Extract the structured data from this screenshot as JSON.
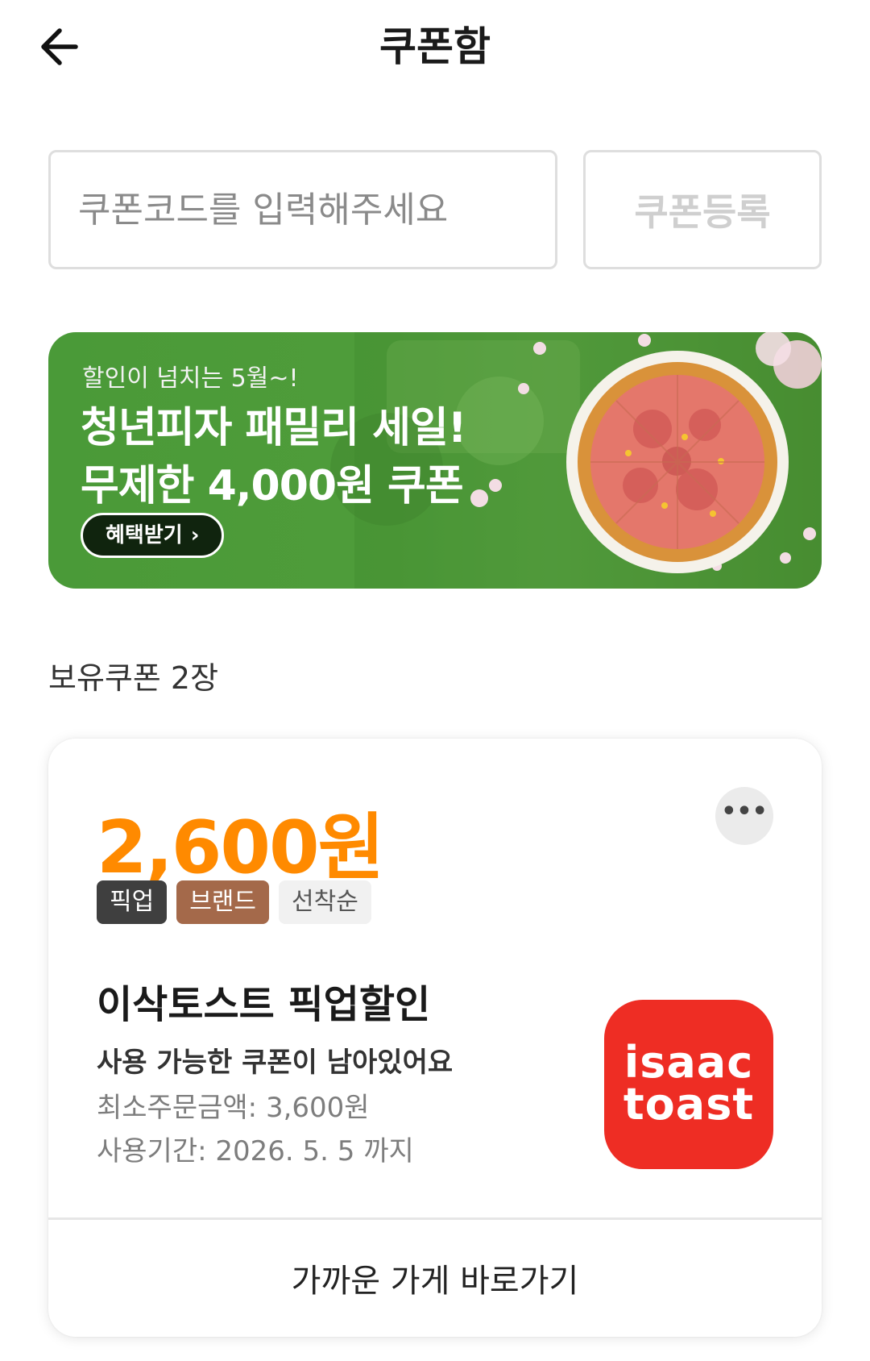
{
  "header": {
    "title": "쿠폰함",
    "back_icon": "arrow-left-icon"
  },
  "coupon_code": {
    "placeholder": "쿠폰코드를 입력해주세요",
    "value": "",
    "register_label": "쿠폰등록"
  },
  "banner": {
    "subtitle": "할인이 넘치는 5월~!",
    "line1": "청년피자 패밀리 세일!",
    "line2": "무제한 4,000원 쿠폰",
    "cta_label": "혜택받기",
    "cta_icon": "›"
  },
  "owned": {
    "label": "보유쿠폰 2장"
  },
  "coupon": {
    "amount": "2,600원",
    "more_icon": "•••",
    "tags": [
      "픽업",
      "브랜드",
      "선착순"
    ],
    "name": "이삭토스트 픽업할인",
    "status": "사용 가능한 쿠폰이 남아있어요",
    "min_order": "최소주문금액: 3,600원",
    "valid_until": "사용기간: 2026. 5. 5 까지",
    "brand_logo": {
      "line1": "isaac",
      "line2": "toast"
    },
    "store_link": "가까운 가게 바로가기"
  },
  "colors": {
    "accent": "#ff8a00",
    "banner_green": "#4f9c3a",
    "tag_pickup": "#3f3f3f",
    "tag_brand": "#a4694a",
    "brand_red": "#ee2d24"
  }
}
